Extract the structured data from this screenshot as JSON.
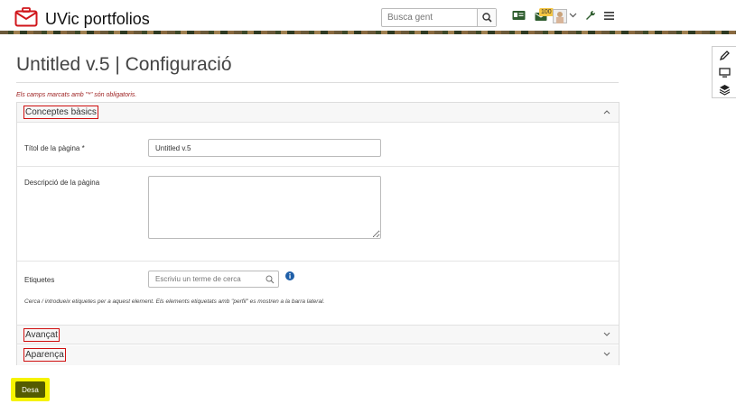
{
  "header": {
    "brand": "UVic portfolios",
    "search_placeholder": "Busca gent",
    "badge_count": "100"
  },
  "page": {
    "title": "Untitled v.5 | Configuració",
    "required_note": "Els camps marcats amb \"*\" són obligatoris."
  },
  "sections": {
    "basic": {
      "label": "Conceptes bàsics",
      "expanded": true
    },
    "advanced": {
      "label": "Avançat",
      "expanded": false
    },
    "appearance": {
      "label": "Aparença",
      "expanded": false
    }
  },
  "form": {
    "title_label": "Títol de la pàgina *",
    "title_value": "Untitled v.5",
    "description_label": "Descripció de la pàgina",
    "description_value": "",
    "tags_label": "Etiquetes",
    "tags_placeholder": "Escriviu un terme de cerca",
    "tags_hint": "Cerca / introdueix etiquetes per a aquest element. Els elements etiquetats amb \"perfil\" es mostren a la barra lateral."
  },
  "actions": {
    "save_label": "Desa"
  },
  "colors": {
    "brand_red": "#d0161b",
    "save_bg": "#545c00",
    "highlight_yellow": "#f6f300",
    "annotation_red": "#d01010"
  }
}
